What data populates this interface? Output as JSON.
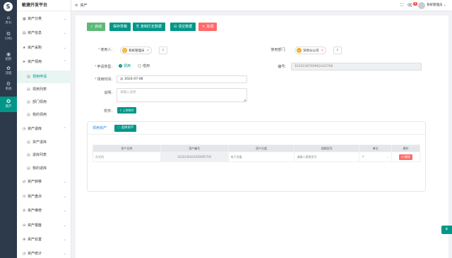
{
  "app": {
    "logo": "S",
    "title": "敏捷开发平台"
  },
  "rail": [
    {
      "icon": "⌂",
      "label": "办公",
      "icon_name": "home-icon"
    },
    {
      "icon": "⧉",
      "label": "CMS",
      "icon_name": "document-icon"
    },
    {
      "icon": "◉",
      "label": "组织",
      "icon_name": "user-icon"
    },
    {
      "icon": "✿",
      "label": "流程",
      "icon_name": "flow-icon"
    },
    {
      "icon": "⚙",
      "label": "系统",
      "icon_name": "gear-icon"
    },
    {
      "icon": "✪",
      "label": "资产",
      "icon_name": "asset-icon"
    }
  ],
  "sidebar": {
    "groups_top": [
      {
        "icon": "▦",
        "label": "资产分类",
        "chev": "⌄"
      },
      {
        "icon": "▤",
        "label": "资产信息",
        "chev": "⌄"
      },
      {
        "icon": "★",
        "label": "资产采购",
        "chev": "⌄"
      },
      {
        "icon": "⎈",
        "label": "资产领用",
        "chev": "⌃"
      }
    ],
    "borrow_items": [
      {
        "icon": "▤",
        "label": "领用申请"
      },
      {
        "icon": "▤",
        "label": "领用列表"
      },
      {
        "icon": "▤",
        "label": "部门领用"
      },
      {
        "icon": "▤",
        "label": "我的领用"
      }
    ],
    "return_group": {
      "icon": "◷",
      "label": "资产退库",
      "chev": "⌃"
    },
    "return_items": [
      {
        "icon": "▤",
        "label": "资产退库"
      },
      {
        "icon": "▤",
        "label": "退库列表"
      },
      {
        "icon": "▤",
        "label": "我的退库"
      }
    ],
    "groups_bottom": [
      {
        "icon": "⇄",
        "label": "资产转移",
        "chev": "⌄"
      },
      {
        "icon": "⊙",
        "label": "资产盘点",
        "chev": "⌄"
      },
      {
        "icon": "⊘",
        "label": "资产维修",
        "chev": "⌄"
      },
      {
        "icon": "⊖",
        "label": "资产报废",
        "chev": "⌄"
      },
      {
        "icon": "⊕",
        "label": "资产处置",
        "chev": "⌄"
      },
      {
        "icon": "◷",
        "label": "资产统计",
        "chev": "⌄"
      }
    ]
  },
  "header": {
    "breadcrumb_icon": "⚙",
    "breadcrumb": "资产",
    "icons": {
      "fullscreen": "⛶",
      "refresh": "⟳",
      "bell": "♫"
    },
    "badge": "9",
    "username": "系统管理员",
    "user_chevron": "⌄"
  },
  "toolbar": {
    "start": {
      "icon": "✓",
      "label": "启动"
    },
    "save_draft": {
      "icon": "",
      "label": "保存草稿"
    },
    "copy": {
      "icon": "⎘",
      "label": "复制历史数据"
    },
    "clear": {
      "icon": "⊟",
      "label": "清空数据"
    },
    "close": {
      "icon": "✕",
      "label": "关闭"
    }
  },
  "form": {
    "user_label": "使用人:",
    "user_tag": "系统管理员",
    "user_tag_icon": "☺",
    "dept_label": "使用部门:",
    "dept_tag": "深圳分公司",
    "dept_tag_icon": "⌂",
    "remove_glyph": "✕",
    "search_glyph": "⌕",
    "type_label": "申请类型:",
    "type_options": [
      "领用",
      "借用"
    ],
    "number_label": "编号:",
    "number_value": "1010238769962432768",
    "time_label": "领用时间:",
    "time_value": "2024-07-08",
    "time_icon": "▦",
    "desc_label": "说明:",
    "desc_placeholder": "请输入说明",
    "resize_glyph": "◢",
    "attach_label": "附件:",
    "upload_label": "上传附件",
    "upload_icon": "⇪"
  },
  "asset_card": {
    "title": "领用资产",
    "select_icon": "◌",
    "select_label": "选择资产",
    "columns": [
      "资产名称",
      "资产编号",
      "资产分类",
      "规格型号",
      "单位",
      "操作"
    ],
    "rows": [
      {
        "name": "台式机",
        "code": "1010236423030095792",
        "category": "电子设备",
        "spec_placeholder": "请输入规格型号",
        "unit": "个",
        "unit_caret": "⌄",
        "delete_icon": "⊟",
        "delete_label": "删除"
      }
    ]
  },
  "fab_icon": "⚘"
}
